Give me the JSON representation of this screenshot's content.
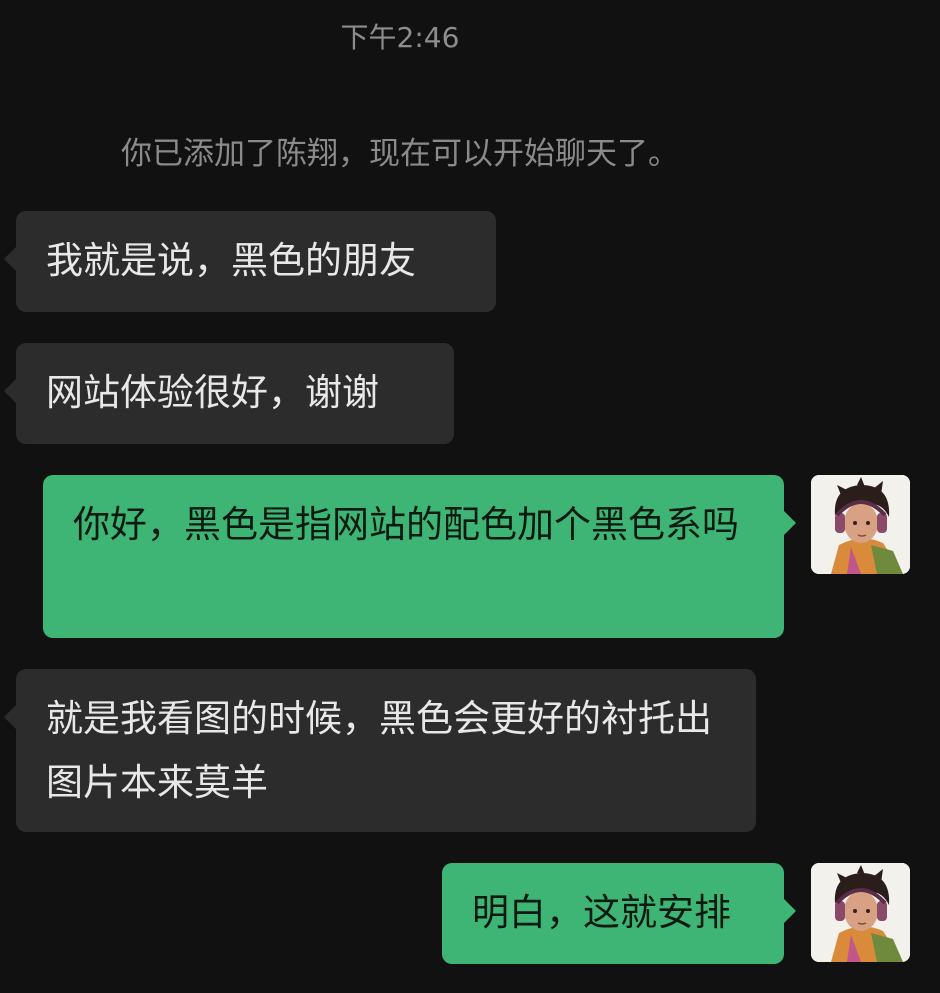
{
  "chat": {
    "timestamp": "下午2:46",
    "system_notice": "你已添加了陈翔，现在可以开始聊天了。",
    "messages": [
      {
        "side": "left",
        "text": "我就是说，黑色的朋友"
      },
      {
        "side": "left",
        "text": "网站体验很好，谢谢"
      },
      {
        "side": "right",
        "text": "你好，黑色是指网站的配色加个黑色系吗"
      },
      {
        "side": "left",
        "text": "就是我看图的时候，黑色会更好的衬托出图片本来莫羊"
      },
      {
        "side": "right",
        "text": "明白，这就安排"
      }
    ]
  },
  "theme": {
    "background": "#111111",
    "incoming_bubble": "#2c2c2c",
    "outgoing_bubble": "#3eb575",
    "muted_text": "#8a8a8a"
  },
  "icons": {
    "self_avatar": "avatar-anime-boy-headphones-icon"
  }
}
